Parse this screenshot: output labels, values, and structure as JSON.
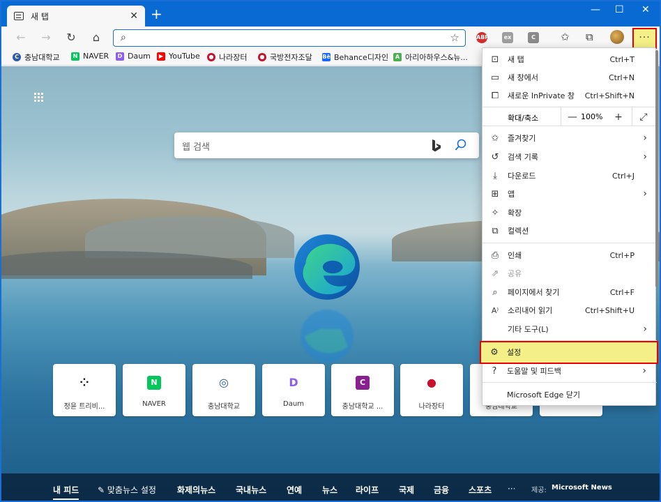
{
  "tab": {
    "title": "새 탭",
    "close": "✕",
    "new": "+"
  },
  "window": {
    "minimize": "—",
    "maximize": "☐",
    "close": "✕"
  },
  "toolbar": {
    "back": "←",
    "forward": "→",
    "refresh": "↻",
    "home": "⌂",
    "address_placeholder": "",
    "favorite": "☆",
    "more": "···",
    "ext_abp": "ABP",
    "ext_ex": "ex",
    "ext_c": "C",
    "favorites_icon": "✩",
    "collections_icon": "⧉"
  },
  "bookmarks": [
    {
      "label": "충남대학교",
      "color": "#2b5aa8",
      "glyph": "C"
    },
    {
      "label": "NAVER",
      "color": "#03c75a",
      "glyph": "N"
    },
    {
      "label": "Daum",
      "color": "#8d5cf0",
      "glyph": "D"
    },
    {
      "label": "YouTube",
      "color": "#ff0000",
      "glyph": "▶"
    },
    {
      "label": "나라장터",
      "color": "#c8102e",
      "glyph": "●"
    },
    {
      "label": "국방전자조달",
      "color": "#c8102e",
      "glyph": "●"
    },
    {
      "label": "Behance디자인",
      "color": "#1769ff",
      "glyph": "Bē"
    },
    {
      "label": "아리아하우스&뉴...",
      "color": "#4caf50",
      "glyph": "A"
    }
  ],
  "newtab": {
    "search_placeholder": "웹 검색",
    "tiles": [
      {
        "label": "정윤 트리비...",
        "glyph": "⁘",
        "color": "#ffffff",
        "fg": "#111"
      },
      {
        "label": "NAVER",
        "glyph": "N",
        "color": "#03c75a",
        "fg": "#fff"
      },
      {
        "label": "충남대학교",
        "glyph": "◎",
        "color": "#ffffff",
        "fg": "#2b5aa8"
      },
      {
        "label": "Daum",
        "glyph": "D",
        "color": "#ffffff",
        "fg": "#8d5cf0"
      },
      {
        "label": "충남대학교 ...",
        "glyph": "C",
        "color": "#8a1f8f",
        "fg": "#fff"
      },
      {
        "label": "나라장터",
        "glyph": "●",
        "color": "#ffffff",
        "fg": "#c8102e"
      },
      {
        "label": "충남대학교",
        "glyph": "",
        "color": "#ffffff",
        "fg": "#fff"
      },
      {
        "label": "",
        "glyph": "",
        "color": "#ffffff",
        "fg": "#fff"
      }
    ],
    "feed": [
      "내 피드",
      "✎ 맞춤뉴스 설정",
      "화제의뉴스",
      "국내뉴스",
      "연예",
      "뉴스",
      "라이프",
      "국제",
      "금융",
      "스포츠",
      "···"
    ],
    "provider_prefix": "제공:",
    "provider": "Microsoft News"
  },
  "menu": {
    "new_tab": {
      "label": "새 탭",
      "shortcut": "Ctrl+T",
      "icon": "⊡"
    },
    "new_window": {
      "label": "새 창에서",
      "shortcut": "Ctrl+N",
      "icon": "▭"
    },
    "inprivate": {
      "label": "새로운 InPrivate 창",
      "shortcut": "Ctrl+Shift+N",
      "icon": "⧠"
    },
    "zoom": {
      "label": "확대/축소",
      "minus": "—",
      "value": "100%",
      "plus": "+",
      "fullscreen": "⤢"
    },
    "favorites": {
      "label": "즐겨찾기",
      "icon": "✩",
      "arrow": "›"
    },
    "history": {
      "label": "검색 기록",
      "icon": "↺",
      "arrow": "›"
    },
    "downloads": {
      "label": "다운로드",
      "shortcut": "Ctrl+J",
      "icon": "⤓"
    },
    "apps": {
      "label": "앱",
      "icon": "⊞",
      "arrow": "›"
    },
    "extensions": {
      "label": "확장",
      "icon": "✧"
    },
    "collections": {
      "label": "컬렉션",
      "icon": "⧉"
    },
    "print": {
      "label": "인쇄",
      "shortcut": "Ctrl+P",
      "icon": "⎙"
    },
    "share": {
      "label": "공유",
      "icon": "⇗"
    },
    "find": {
      "label": "페이지에서 찾기",
      "shortcut": "Ctrl+F",
      "icon": "⌕"
    },
    "read_aloud": {
      "label": "소리내어 읽기",
      "shortcut": "Ctrl+Shift+U",
      "icon": "A⁾"
    },
    "more_tools": {
      "label": "기타 도구(L)",
      "arrow": "›"
    },
    "settings": {
      "label": "설정",
      "icon": "⚙"
    },
    "help": {
      "label": "도움말 및 피드백",
      "icon": "?",
      "arrow": "›"
    },
    "close_edge": {
      "label": "Microsoft Edge 닫기"
    }
  },
  "colors": {
    "highlight": "#f4f087",
    "highlight_border": "#ee0000",
    "accent": "#0a6ad4"
  }
}
